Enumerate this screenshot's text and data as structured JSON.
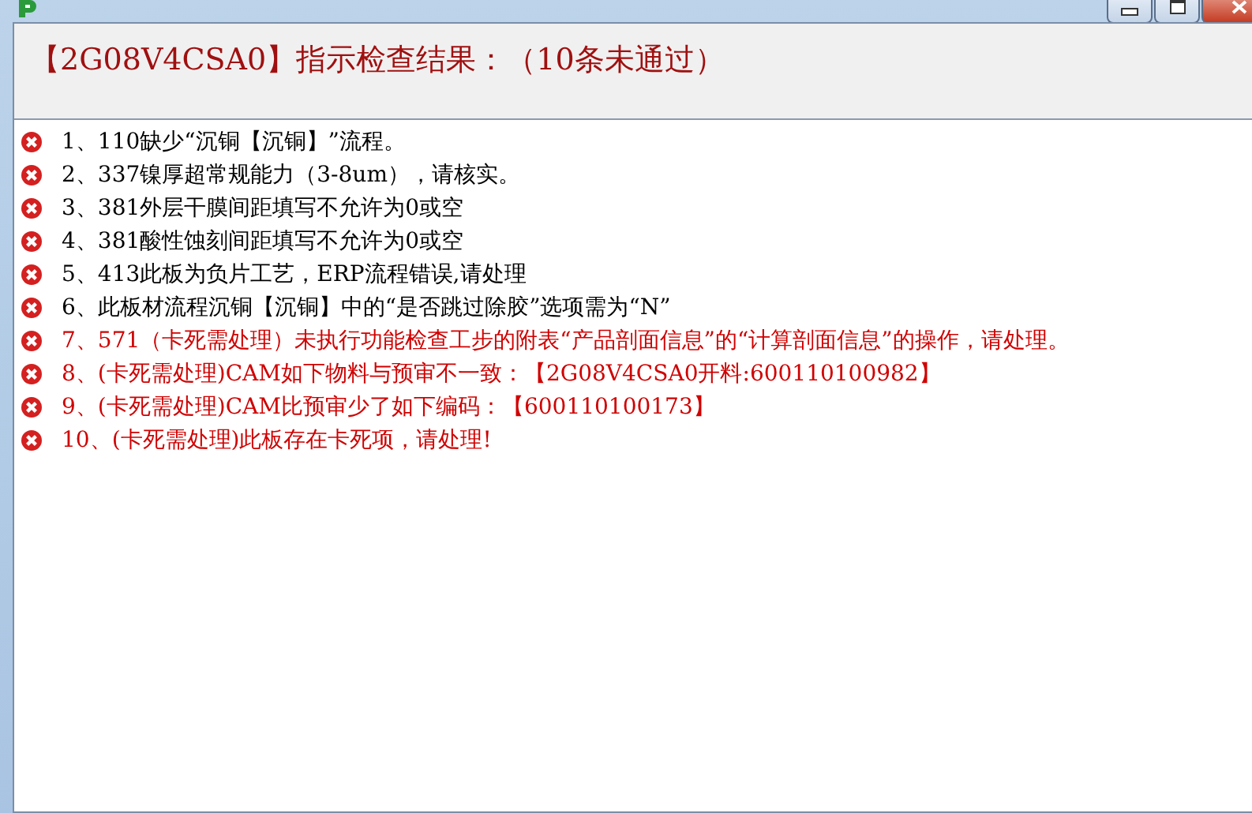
{
  "header": {
    "title": "【2G08V4CSA0】指示检查结果：（10条未通过）"
  },
  "results": [
    {
      "kind": "normal",
      "text": "1、110缺少“沉铜【沉铜】”流程。"
    },
    {
      "kind": "normal",
      "text": "2、337镍厚超常规能力（3-8um），请核实。"
    },
    {
      "kind": "normal",
      "text": "3、381外层干膜间距填写不允许为0或空"
    },
    {
      "kind": "normal",
      "text": "4、381酸性蚀刻间距填写不允许为0或空"
    },
    {
      "kind": "normal",
      "text": "5、413此板为负片工艺，ERP流程错误,请处理"
    },
    {
      "kind": "normal",
      "text": "6、此板材流程沉铜【沉铜】中的“是否跳过除胶”选项需为“N”"
    },
    {
      "kind": "blocking",
      "text": "7、571（卡死需处理）未执行功能检查工步的附表“产品剖面信息”的“计算剖面信息”的操作，请处理。"
    },
    {
      "kind": "blocking",
      "text": "8、(卡死需处理)CAM如下物料与预审不一致：【2G08V4CSA0开料:600110100982】"
    },
    {
      "kind": "blocking",
      "text": "9、(卡死需处理)CAM比预审少了如下编码：【600110100173】"
    },
    {
      "kind": "blocking",
      "text": "10、(卡死需处理)此板存在卡死项，请处理!"
    }
  ]
}
